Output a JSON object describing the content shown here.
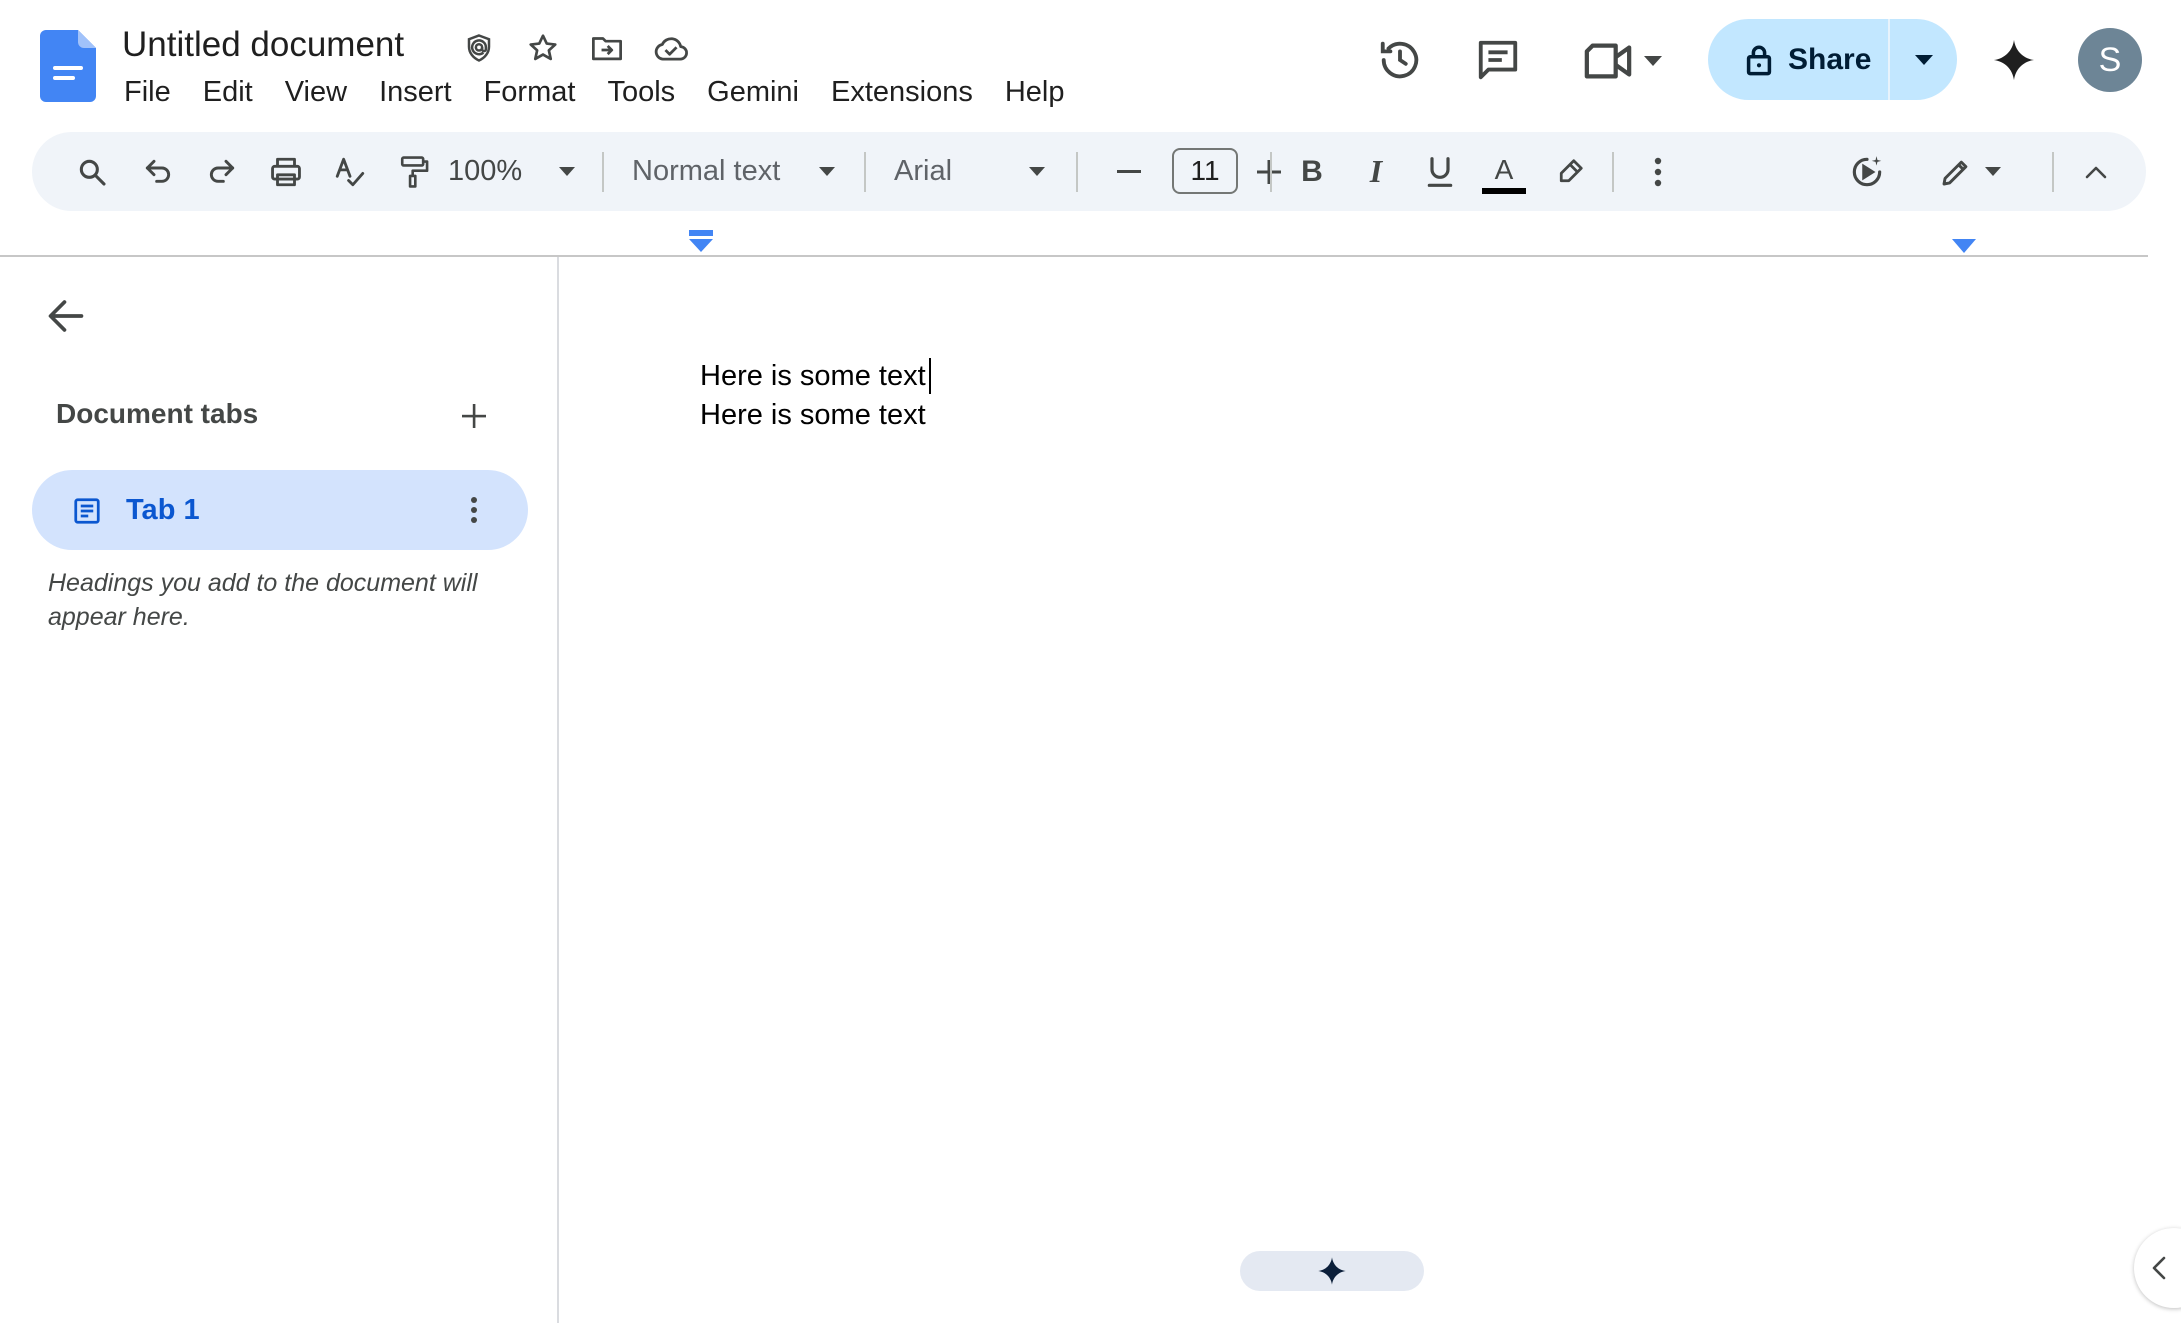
{
  "app": {
    "doc_title": "Untitled document",
    "accent_color": "#0b57d0",
    "share_bg_color": "#c2e7ff"
  },
  "menu": [
    {
      "id": "file",
      "label": "File"
    },
    {
      "id": "edit",
      "label": "Edit"
    },
    {
      "id": "view",
      "label": "View"
    },
    {
      "id": "insert",
      "label": "Insert"
    },
    {
      "id": "format",
      "label": "Format"
    },
    {
      "id": "tools",
      "label": "Tools"
    },
    {
      "id": "gemini",
      "label": "Gemini"
    },
    {
      "id": "extensions",
      "label": "Extensions"
    },
    {
      "id": "help",
      "label": "Help"
    }
  ],
  "header": {
    "share_label": "Share",
    "avatar_initial": "S"
  },
  "toolbar": {
    "zoom": "100%",
    "paragraph_style": "Normal text",
    "font_family": "Arial",
    "font_size": "11",
    "text_color": "#000000"
  },
  "sidebar": {
    "heading": "Document tabs",
    "tabs": [
      {
        "label": "Tab 1",
        "selected": true
      }
    ],
    "hint": "Headings you add to the document will appear here."
  },
  "document": {
    "lines": [
      "Here is some text",
      "Here is some text"
    ]
  }
}
